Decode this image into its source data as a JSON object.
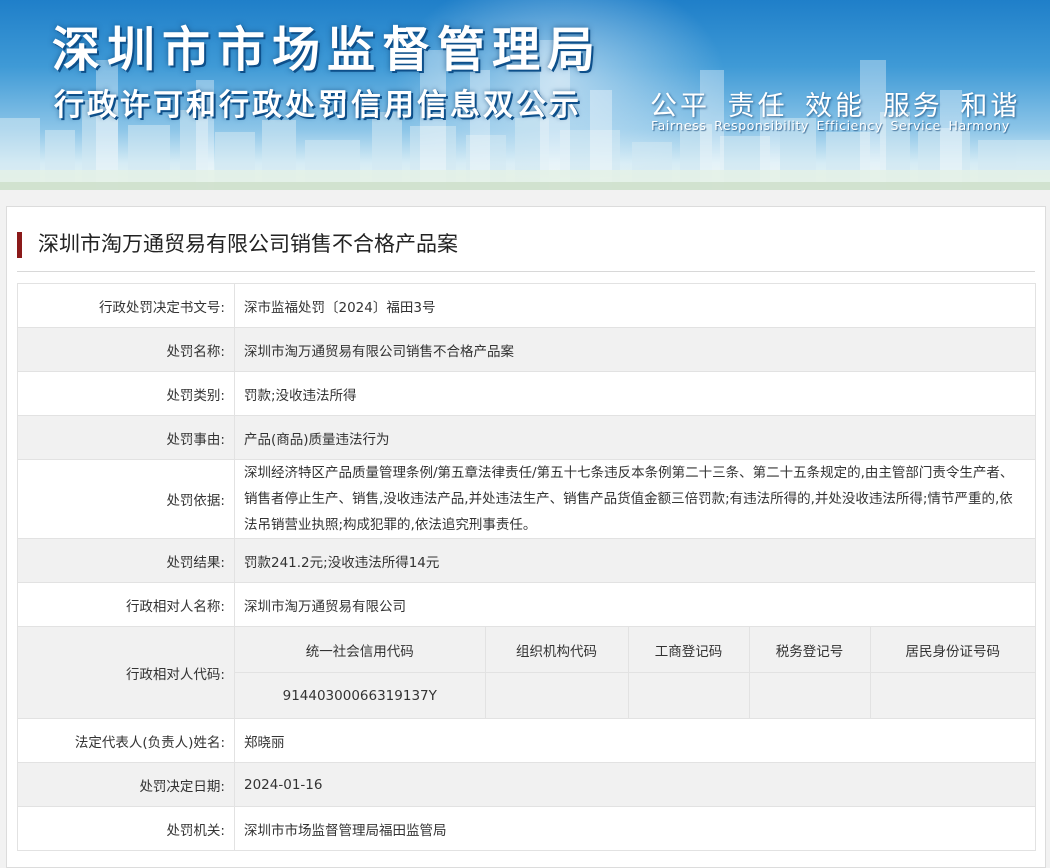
{
  "banner": {
    "title_main": "深圳市市场监督管理局",
    "title_sub": "行政许可和行政处罚信用信息双公示",
    "slogan": "公平 责任 效能 服务 和谐",
    "slogan_en": "Fairness Responsibility Efficiency Service Harmony"
  },
  "case": {
    "title": "深圳市淘万通贸易有限公司销售不合格产品案"
  },
  "rows": [
    {
      "label": "行政处罚决定书文号:",
      "value": "深市监福处罚〔2024〕福田3号"
    },
    {
      "label": "处罚名称:",
      "value": "深圳市淘万通贸易有限公司销售不合格产品案"
    },
    {
      "label": "处罚类别:",
      "value": "罚款;没收违法所得"
    },
    {
      "label": "处罚事由:",
      "value": "产品(商品)质量违法行为"
    },
    {
      "label": "处罚依据:",
      "value": "深圳经济特区产品质量管理条例/第五章法律责任/第五十七条违反本条例第二十三条、第二十五条规定的,由主管部门责令生产者、销售者停止生产、销售,没收违法产品,并处违法生产、销售产品货值金额三倍罚款;有违法所得的,并处没收违法所得;情节严重的,依法吊销营业执照;构成犯罪的,依法追究刑事责任。"
    },
    {
      "label": "处罚结果:",
      "value": "罚款241.2元;没收违法所得14元"
    },
    {
      "label": "行政相对人名称:",
      "value": "深圳市淘万通贸易有限公司"
    },
    {
      "label": "行政相对人代码:",
      "value": ""
    },
    {
      "label": "法定代表人(负责人)姓名:",
      "value": "郑晓丽"
    },
    {
      "label": "处罚决定日期:",
      "value": "2024-01-16"
    },
    {
      "label": "处罚机关:",
      "value": "深圳市市场监督管理局福田监管局"
    }
  ],
  "codes": {
    "headers": [
      "统一社会信用代码",
      "组织机构代码",
      "工商登记码",
      "税务登记号",
      "居民身份证号码"
    ],
    "values": [
      "91440300066319137Y",
      "",
      "",
      "",
      ""
    ]
  }
}
